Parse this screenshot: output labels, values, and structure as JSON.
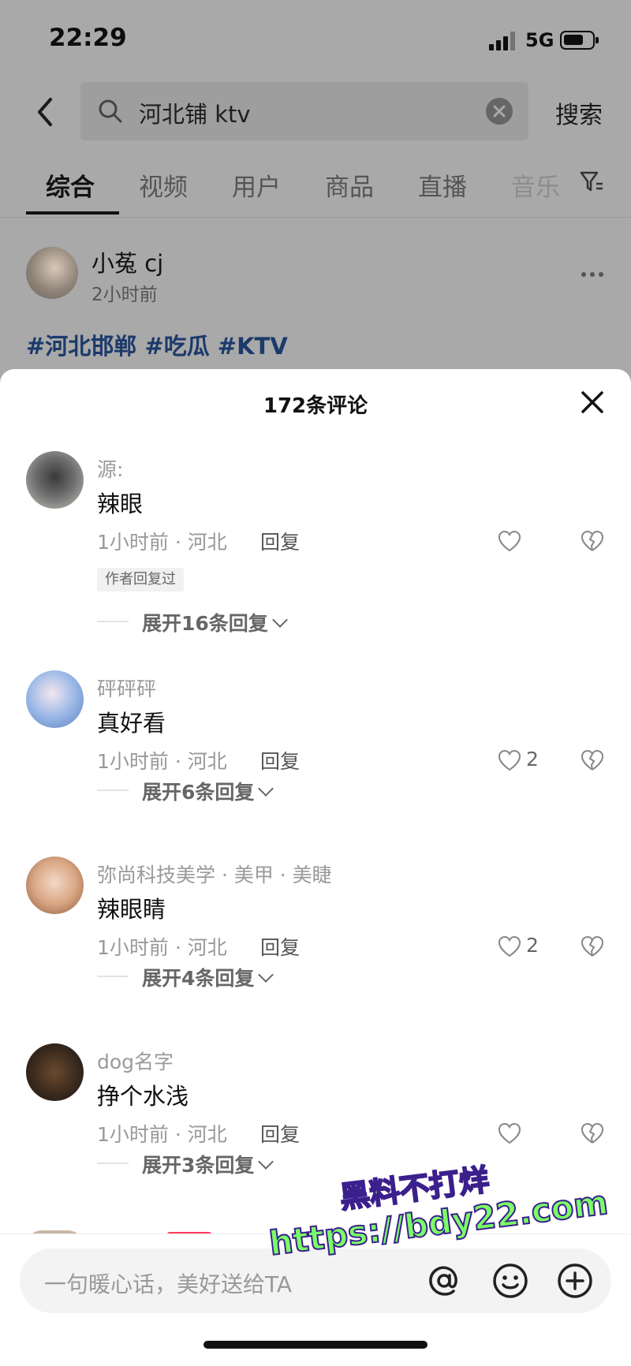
{
  "status_bar": {
    "time": "22:29",
    "network": "5G"
  },
  "search": {
    "query": "河北铺 ktv",
    "submit_label": "搜索"
  },
  "tabs": [
    {
      "label": "综合",
      "active": true
    },
    {
      "label": "视频"
    },
    {
      "label": "用户"
    },
    {
      "label": "商品"
    },
    {
      "label": "直播"
    },
    {
      "label": "音乐"
    }
  ],
  "post": {
    "user": "小菟 cj",
    "time": "2小时前",
    "tags": "#河北邯郸 #吃瓜 #KTV"
  },
  "comments_sheet": {
    "title": "172条评论",
    "comments": [
      {
        "user": "源:",
        "text": "辣眼",
        "meta": "1小时前 · 河北",
        "reply": "回复",
        "likes": "",
        "badge": "作者回复过",
        "expand": "展开16条回复"
      },
      {
        "user": "砰砰砰",
        "text": "真好看",
        "meta": "1小时前 · 河北",
        "reply": "回复",
        "likes": "2",
        "expand": "展开6条回复"
      },
      {
        "user": "弥尚科技美学 · 美甲 · 美睫",
        "text": "辣眼睛",
        "meta": "1小时前 · 河北",
        "reply": "回复",
        "likes": "2",
        "expand": "展开4条回复"
      },
      {
        "user": "dog名字",
        "text": "挣个水浅",
        "meta": "1小时前 · 河北",
        "reply": "回复",
        "likes": "",
        "expand": "展开3条回复"
      }
    ],
    "composer_placeholder": "一句暖心话，美好送给TA"
  },
  "watermark": {
    "line1": "黑料不打烊",
    "line2": "https://bdy22.com"
  },
  "colors": {
    "accent_tag": "#1b3a6b",
    "watermark_text": "#7aff66",
    "watermark_stroke": "#3b1f8c"
  }
}
